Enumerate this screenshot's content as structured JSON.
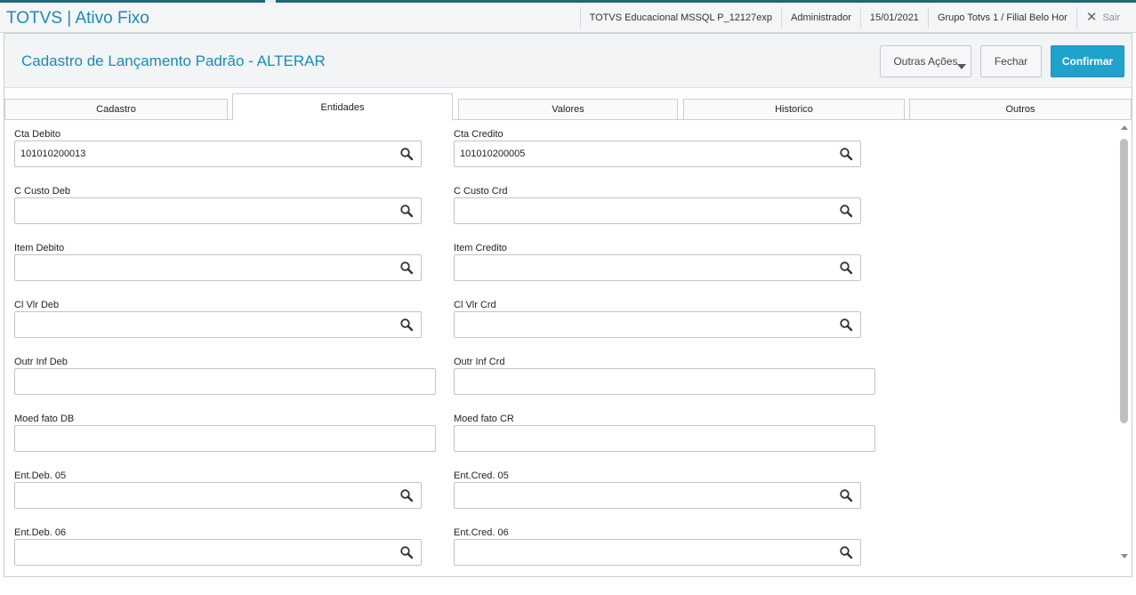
{
  "app": {
    "title": "TOTVS | Ativo Fixo",
    "environment": "TOTVS Educacional MSSQL P_12127exp",
    "user": "Administrador",
    "date": "15/01/2021",
    "branch": "Grupo Totvs 1 / Filial Belo Hor",
    "logout_label": "Sair",
    "logout_icon": "close-icon"
  },
  "form": {
    "title": "Cadastro de Lançamento Padrão - ALTERAR",
    "buttons": {
      "other_actions": "Outras Ações",
      "close": "Fechar",
      "confirm": "Confirmar"
    }
  },
  "tabs": [
    {
      "label": "Cadastro",
      "active": false
    },
    {
      "label": "Entidades",
      "active": true
    },
    {
      "label": "Valores",
      "active": false
    },
    {
      "label": "Historico",
      "active": false
    },
    {
      "label": "Outros",
      "active": false
    }
  ],
  "fields": {
    "cta_debito": {
      "label": "Cta Debito",
      "value": "101010200013",
      "lookup": true
    },
    "cta_credito": {
      "label": "Cta Credito",
      "value": "101010200005",
      "lookup": true
    },
    "c_custo_deb": {
      "label": "C Custo Deb",
      "value": "",
      "lookup": true
    },
    "c_custo_crd": {
      "label": "C Custo Crd",
      "value": "",
      "lookup": true
    },
    "item_debito": {
      "label": "Item Debito",
      "value": "",
      "lookup": true
    },
    "item_credito": {
      "label": "Item Credito",
      "value": "",
      "lookup": true
    },
    "cl_vlr_deb": {
      "label": "Cl Vlr Deb",
      "value": "",
      "lookup": true
    },
    "cl_vlr_crd": {
      "label": "Cl Vlr Crd",
      "value": "",
      "lookup": true
    },
    "outr_inf_deb": {
      "label": "Outr Inf Deb",
      "value": "",
      "lookup": false
    },
    "outr_inf_crd": {
      "label": "Outr Inf Crd",
      "value": "",
      "lookup": false
    },
    "moed_fato_db": {
      "label": "Moed fato DB",
      "value": "",
      "lookup": false
    },
    "moed_fato_cr": {
      "label": "Moed fato CR",
      "value": "",
      "lookup": false
    },
    "ent_deb_05": {
      "label": "Ent.Deb. 05",
      "value": "",
      "lookup": true
    },
    "ent_cred_05": {
      "label": "Ent.Cred. 05",
      "value": "",
      "lookup": true
    },
    "ent_deb_06": {
      "label": "Ent.Deb. 06",
      "value": "",
      "lookup": true
    },
    "ent_cred_06": {
      "label": "Ent.Cred. 06",
      "value": "",
      "lookup": true
    }
  },
  "colors": {
    "accent": "#1a8bb4",
    "confirm_button": "#1fa3cc",
    "top_strip": "#1c6a77"
  }
}
